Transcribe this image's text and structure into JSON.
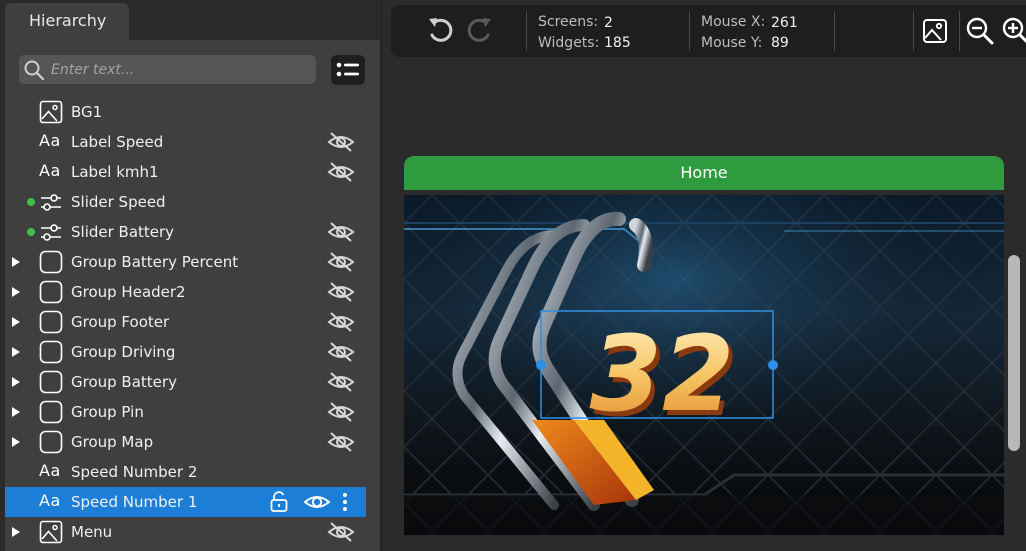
{
  "hierarchy": {
    "tab_label": "Hierarchy",
    "search_placeholder": "Enter text...",
    "items": [
      {
        "label": "BG1",
        "icon": "image-icon",
        "expandable": false,
        "dot": false,
        "hidden": false
      },
      {
        "label": "Label Speed",
        "icon": "label-icon",
        "icon_text": "Aa",
        "expandable": false,
        "dot": false,
        "hidden": true
      },
      {
        "label": "Label kmh1",
        "icon": "label-icon",
        "icon_text": "Aa",
        "expandable": false,
        "dot": false,
        "hidden": true
      },
      {
        "label": "Slider Speed",
        "icon": "slider-icon",
        "expandable": false,
        "dot": true,
        "hidden": false
      },
      {
        "label": "Slider Battery",
        "icon": "slider-icon",
        "expandable": false,
        "dot": true,
        "hidden": true
      },
      {
        "label": "Group Battery Percent",
        "icon": "group-icon",
        "expandable": true,
        "dot": false,
        "hidden": true
      },
      {
        "label": "Group Header2",
        "icon": "group-icon",
        "expandable": true,
        "dot": false,
        "hidden": true
      },
      {
        "label": "Group Footer",
        "icon": "group-icon",
        "expandable": true,
        "dot": false,
        "hidden": true
      },
      {
        "label": "Group Driving",
        "icon": "group-icon",
        "expandable": true,
        "dot": false,
        "hidden": true
      },
      {
        "label": "Group Battery",
        "icon": "group-icon",
        "expandable": true,
        "dot": false,
        "hidden": true
      },
      {
        "label": "Group Pin",
        "icon": "group-icon",
        "expandable": true,
        "dot": false,
        "hidden": true
      },
      {
        "label": "Group Map",
        "icon": "group-icon",
        "expandable": true,
        "dot": false,
        "hidden": true
      },
      {
        "label": "Speed Number 2",
        "icon": "label-icon",
        "icon_text": "Aa",
        "expandable": false,
        "dot": false,
        "hidden": false
      },
      {
        "label": "Speed Number 1",
        "icon": "label-icon",
        "icon_text": "Aa",
        "expandable": false,
        "dot": false,
        "hidden": false,
        "selected": true
      },
      {
        "label": "Menu",
        "icon": "image-icon",
        "expandable": true,
        "dot": false,
        "hidden": true
      }
    ]
  },
  "toolbar": {
    "screens_label": "Screens:",
    "screens_value": "2",
    "widgets_label": "Widgets:",
    "widgets_value": "185",
    "mouse_x_label": "Mouse X:",
    "mouse_x_value": "261",
    "mouse_y_label": "Mouse Y:",
    "mouse_y_value": "89"
  },
  "canvas": {
    "screen_name": "Home",
    "speed_value": "32"
  },
  "colors": {
    "selection": "#1c7ed6",
    "screen_header": "#2e9c3e",
    "status_dot": "#3fbf4a",
    "handle": "#2f8fe8"
  }
}
